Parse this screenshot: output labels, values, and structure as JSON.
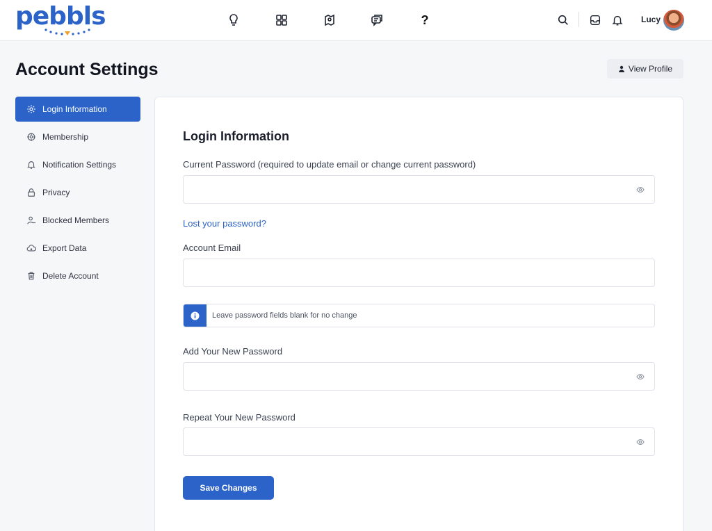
{
  "brand": {
    "logo_text": "pebbls"
  },
  "header": {
    "nav_icons": [
      "bulb-icon",
      "grid-icon",
      "map-icon",
      "chat-icon",
      "help-icon"
    ],
    "help_label": "?",
    "user_name": "Lucy"
  },
  "page": {
    "title": "Account Settings",
    "view_profile_label": "View Profile"
  },
  "sidebar": {
    "items": [
      {
        "label": "Login Information",
        "icon": "gear-icon",
        "active": true
      },
      {
        "label": "Membership",
        "icon": "membership-icon",
        "active": false
      },
      {
        "label": "Notification Settings",
        "icon": "bell-icon",
        "active": false
      },
      {
        "label": "Privacy",
        "icon": "lock-icon",
        "active": false
      },
      {
        "label": "Blocked Members",
        "icon": "blocked-user-icon",
        "active": false
      },
      {
        "label": "Export Data",
        "icon": "cloud-icon",
        "active": false
      },
      {
        "label": "Delete Account",
        "icon": "trash-icon",
        "active": false
      }
    ]
  },
  "form": {
    "title": "Login Information",
    "current_password_label": "Current Password (required to update email or change current password)",
    "current_password_value": "",
    "lost_password_link": "Lost your password?",
    "email_label": "Account Email",
    "email_value": "",
    "notice_text": "Leave password fields blank for no change",
    "new_password_label": "Add Your New Password",
    "repeat_password_label": "Repeat Your New Password",
    "save_label": "Save Changes"
  },
  "colors": {
    "accent": "#2b63c9",
    "background": "#f6f7f9"
  }
}
